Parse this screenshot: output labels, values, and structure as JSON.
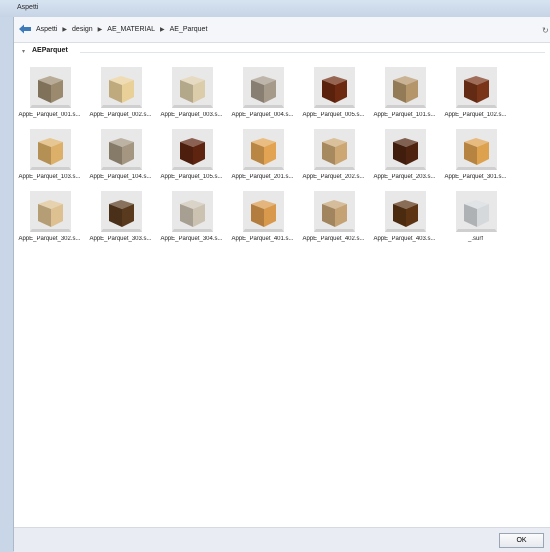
{
  "window": {
    "title": "Aspetti"
  },
  "toolbar": {
    "back_icon": "back-arrow-icon",
    "breadcrumb": [
      "Aspetti",
      "design",
      "AE_MATERIAL",
      "AE_Parquet"
    ],
    "separator": "▶"
  },
  "group": {
    "label": "AEParquet",
    "expanded": true
  },
  "materials": [
    {
      "name": "AppE_Parquet_001.s...",
      "color": "#9c8a6e"
    },
    {
      "name": "AppE_Parquet_002.s...",
      "color": "#e9cf98"
    },
    {
      "name": "AppE_Parquet_003.s...",
      "color": "#dccdaa"
    },
    {
      "name": "AppE_Parquet_004.s...",
      "color": "#a69a8a"
    },
    {
      "name": "AppE_Parquet_005.s...",
      "color": "#6e2a10"
    },
    {
      "name": "AppE_Parquet_101.s...",
      "color": "#b4966a"
    },
    {
      "name": "AppE_Parquet_102.s...",
      "color": "#7a3418"
    },
    {
      "name": "AppE_Parquet_103.s...",
      "color": "#dcb068"
    },
    {
      "name": "AppE_Parquet_104.s...",
      "color": "#a49680"
    },
    {
      "name": "AppE_Parquet_105.s...",
      "color": "#5e2410"
    },
    {
      "name": "AppE_Parquet_201.s...",
      "color": "#e2a452"
    },
    {
      "name": "AppE_Parquet_202.s...",
      "color": "#cca774"
    },
    {
      "name": "AppE_Parquet_203.s...",
      "color": "#4e230f"
    },
    {
      "name": "AppE_Parquet_301.s...",
      "color": "#dea14e"
    },
    {
      "name": "AppE_Parquet_302.s...",
      "color": "#ddc190"
    },
    {
      "name": "AppE_Parquet_303.s...",
      "color": "#5a3a1e"
    },
    {
      "name": "AppE_Parquet_304.s...",
      "color": "#ccc2b2"
    },
    {
      "name": "AppE_Parquet_401.s...",
      "color": "#d9994c"
    },
    {
      "name": "AppE_Parquet_402.s...",
      "color": "#c4a274"
    },
    {
      "name": "AppE_Parquet_403.s...",
      "color": "#5c3414"
    },
    {
      "name": "_.surf",
      "color": "#d6d9dc"
    }
  ],
  "footer": {
    "ok_label": "OK"
  }
}
